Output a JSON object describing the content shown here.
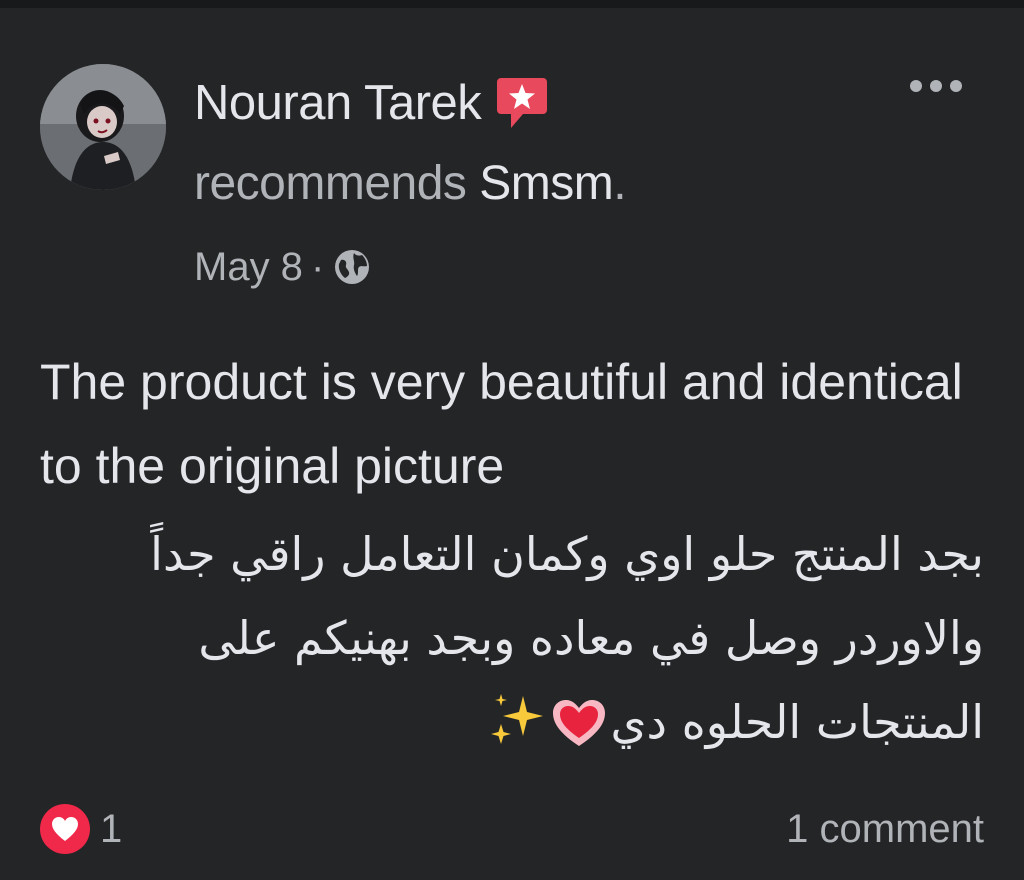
{
  "post": {
    "author": {
      "name": "Nouran Tarek",
      "avatar_icon": "profile-photo",
      "badge_icon": "recommendation-star-icon"
    },
    "recommendation": {
      "verb": "recommends",
      "page": "Smsm",
      "end_punct": "."
    },
    "meta": {
      "date": "May 8",
      "separator": "·",
      "privacy_icon": "globe-icon"
    },
    "body": {
      "english": "The product is very beautiful and identical to the original picture",
      "arabic": "بجد المنتج حلو اوي وكمان التعامل راقي جداً والاوردر وصل في معاده وبجد بهنيكم على المنتجات الحلوه دي",
      "emojis": [
        "heart-emoji",
        "sparkles-emoji"
      ]
    },
    "reactions": {
      "icon": "heart-reaction-icon",
      "count": "1"
    },
    "comments_label": "1 comment",
    "more_icon": "more-options-icon"
  },
  "colors": {
    "background": "#242526",
    "text_primary": "#e4e6eb",
    "text_secondary": "#b0b3b8",
    "reaction_red": "#f02849",
    "badge_pink": "#e9495d"
  }
}
